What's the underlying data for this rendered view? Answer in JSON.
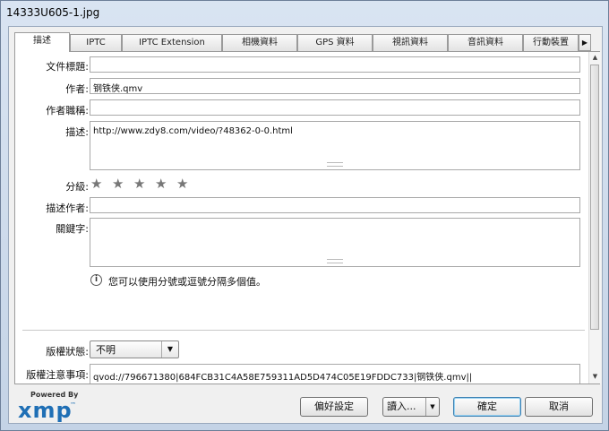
{
  "window": {
    "title": "14333U605-1.jpg"
  },
  "tabs": [
    "描述",
    "IPTC",
    "IPTC Extension",
    "相機資料",
    "GPS 資料",
    "視訊資料",
    "音訊資料",
    "行動裝置"
  ],
  "tab_scroll": "▶",
  "fields": {
    "doc_title": {
      "label": "文件標題:",
      "value": ""
    },
    "author": {
      "label": "作者:",
      "value": "钢铁侠.qmv"
    },
    "author_title": {
      "label": "作者職稱:",
      "value": ""
    },
    "description": {
      "label": "描述:",
      "value": "http://www.zdy8.com/video/?48362-0-0.html"
    },
    "rating": {
      "label": "分級:",
      "stars": 5,
      "filled": 0
    },
    "desc_writer": {
      "label": "描述作者:",
      "value": ""
    },
    "keywords": {
      "label": "關鍵字:",
      "value": ""
    },
    "hint": "您可以使用分號或逗號分隔多個值。",
    "copyright_status": {
      "label": "版權狀態:",
      "value": "不明"
    },
    "copyright_notice": {
      "label": "版權注意事項:",
      "value": "qvod://796671380|684FCB31C4A58E759311AD5D474C05E19FDDC733|钢铁侠.qmv||"
    }
  },
  "buttons": {
    "prefs": "偏好設定",
    "import": "讀入...",
    "ok": "確定",
    "cancel": "取消"
  },
  "xmp": {
    "powered": "Powered By",
    "logo": "xmp",
    "tm": "™"
  }
}
